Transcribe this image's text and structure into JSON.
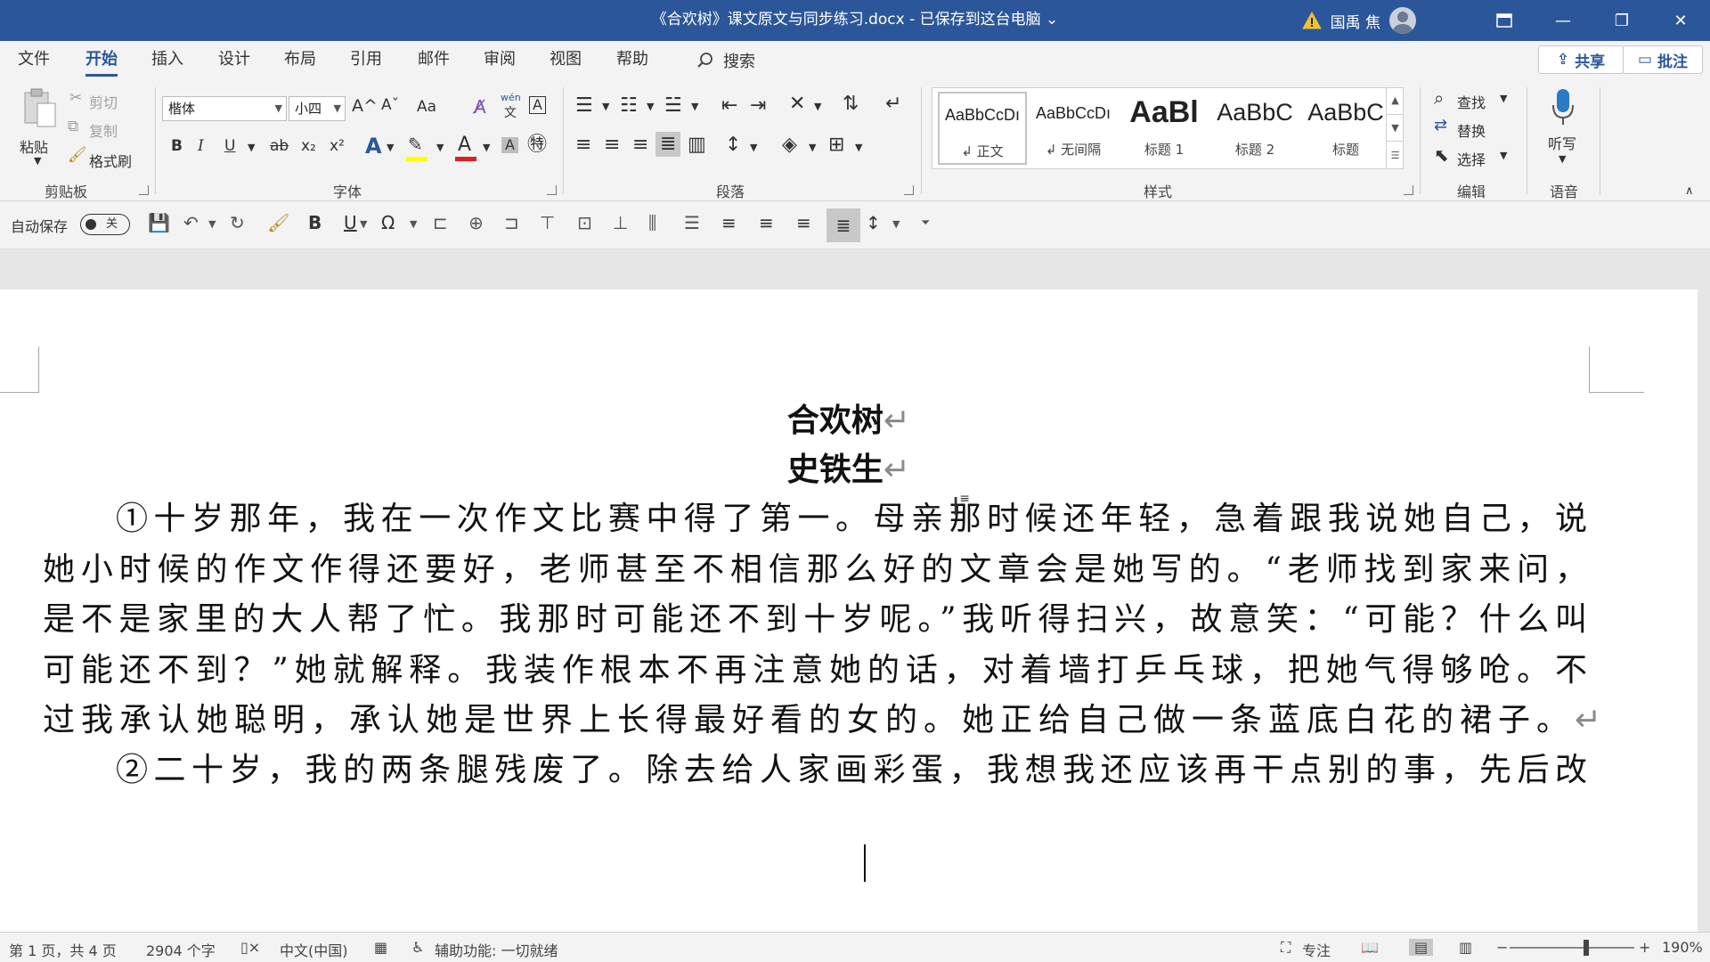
{
  "titlebar": {
    "doc_title": "《合欢树》课文原文与同步练习.docx - 已保存到这台电脑 ⌄",
    "user": "国禹 焦",
    "ribbon_display_icon": "ribbon-display-icon",
    "minimize": "—",
    "restore": "❐",
    "close": "✕"
  },
  "tabs": [
    "文件",
    "开始",
    "插入",
    "设计",
    "布局",
    "引用",
    "邮件",
    "审阅",
    "视图",
    "帮助"
  ],
  "search": {
    "label": "搜索"
  },
  "share": {
    "label": "共享"
  },
  "comment": {
    "label": "批注"
  },
  "clipboard": {
    "paste": "粘贴",
    "cut": "剪切",
    "copy": "复制",
    "format_painter": "格式刷",
    "group": "剪贴板"
  },
  "font": {
    "name": "楷体",
    "size": "小四",
    "group": "字体",
    "grow": "A^",
    "shrink": "Aˇ",
    "case": "Aa",
    "bold": "B",
    "italic": "I",
    "underline": "U",
    "strike": "ab",
    "subscript": "x₂",
    "superscript": "x²",
    "phonetic": "wén",
    "highlight_color": "#ffff00",
    "font_color": "#e02020"
  },
  "paragraph": {
    "group": "段落"
  },
  "styles": {
    "group": "样式",
    "items": [
      {
        "sample": "AaBbCcDı",
        "name": "↲ 正文"
      },
      {
        "sample": "AaBbCcDı",
        "name": "↲ 无间隔"
      },
      {
        "sample": "AaBl",
        "name": "标题 1"
      },
      {
        "sample": "AaBbC",
        "name": "标题 2"
      },
      {
        "sample": "AaBbC",
        "name": "标题"
      }
    ]
  },
  "editing": {
    "find": "查找",
    "replace": "替换",
    "select": "选择",
    "group": "编辑"
  },
  "voice": {
    "dictate": "听写",
    "group": "语音"
  },
  "qat": {
    "autosave": "自动保存",
    "toggle": "关",
    "bold": "B",
    "underline": "U"
  },
  "document": {
    "title": "合欢树",
    "author": "史铁生",
    "para_mark": "↵",
    "lines": [
      "①十岁那年，我在一次作文比赛中得了第一。母亲那时候还年轻，急着跟我说她自己，说",
      "她小时候的作文作得还要好，老师甚至不相信那么好的文章会是她写的。“老师找到家来问，",
      "是不是家里的大人帮了忙。我那时可能还不到十岁呢。”我听得扫兴，故意笑：“可能？什么叫",
      "可能还不到？”她就解释。我装作根本不再注意她的话，对着墙打乒乓球，把她气得够呛。不",
      "过我承认她聪明，承认她是世界上长得最好看的女的。她正给自己做一条蓝底白花的裙子。",
      "②二十岁，我的两条腿残废了。除去给人家画彩蛋，我想我还应该再干点别的事，先后改"
    ]
  },
  "status": {
    "page": "第 1 页，共 4 页",
    "words": "2904 个字",
    "language": "中文(中国)",
    "accessibility": "辅助功能: 一切就绪",
    "focus": "专注",
    "zoom": "190%",
    "zoom_level_percent": 190
  },
  "colors": {
    "accent": "#2b579a",
    "ribbon_bg": "#f3f3f3",
    "page_bg": "#ffffff",
    "canvas_bg": "#e6e6e6"
  }
}
